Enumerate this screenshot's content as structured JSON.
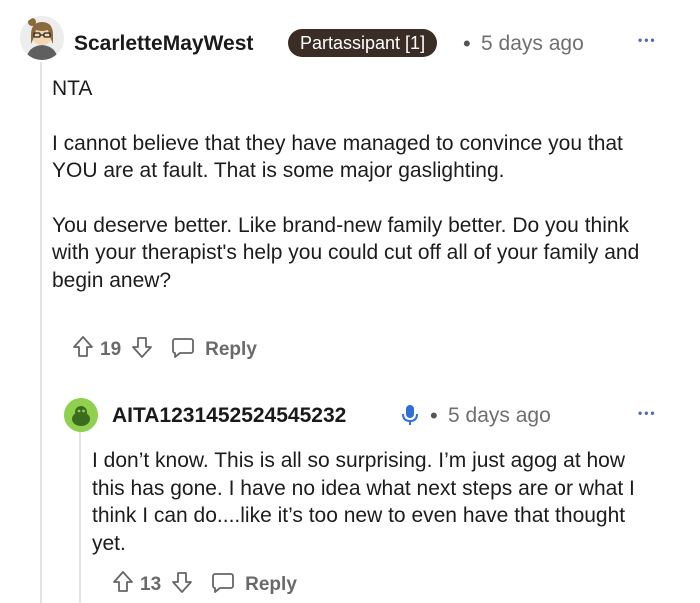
{
  "comment": {
    "username": "ScarletteMayWest",
    "badge": "Partassipant [1]",
    "separator": "•",
    "time": "5 days ago",
    "more": "•••",
    "paragraphs": [
      "NTA",
      "I cannot believe that they have managed to convince you that YOU are at fault. That is some major gaslighting.",
      "You deserve better. Like brand-new family better. Do you think with your therapist's help you could cut off all of your family and begin anew?"
    ],
    "votes": "19",
    "reply_label": "Reply",
    "upvote_icon": "arrow-up-icon",
    "downvote_icon": "arrow-down-icon",
    "reply_icon": "speech-bubble-icon"
  },
  "reply": {
    "username": "AITA1231452524545232",
    "op_icon": "microphone-icon",
    "separator": "•",
    "time": "5 days ago",
    "more": "•••",
    "text": "I don’t know. This is all so surprising. I’m just agog at how this has gone. I have no idea what next steps are or what I think I can do....like it’s too new to even have that thought yet.",
    "votes": "13",
    "reply_label": "Reply"
  },
  "colors": {
    "badge_bg": "#3a2d26",
    "accent_blue": "#2f6fd6",
    "avatar_green": "#8fd14f"
  }
}
